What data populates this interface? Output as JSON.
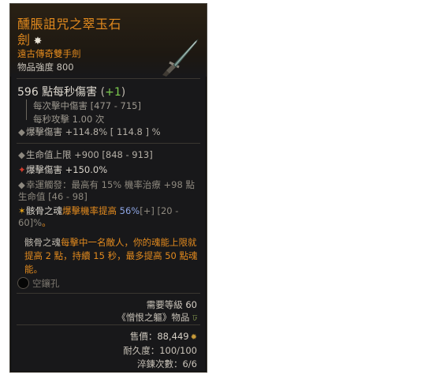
{
  "item": {
    "name_line1": "醺脹詛咒之翠玉石",
    "name_line2": "劍",
    "type": "遠古傳奇雙手劍",
    "power": "物品強度 800"
  },
  "dps": {
    "value": "596 點每秒傷害",
    "open": "(",
    "bonus": "+1",
    "close": ")"
  },
  "damage_details": {
    "hit": "每次擊中傷害 [477 - 715]",
    "speed": "每秒攻擊 1.00 次",
    "crit": "爆擊傷害 +114.8%  [ 114.8 ] %"
  },
  "affixes": {
    "life": "生命值上限 +900 [848 - 913]",
    "crit_dmg": "爆擊傷害 +150.0%",
    "lucky_hit": "幸運觸發：最高有 15% 機率治療 +98 點生命值 [46 - 98]",
    "aspect_name": "骸骨之魂",
    "aspect_orange": "爆擊機率提高",
    "aspect_value": "56%",
    "aspect_rest": "[+] [20 - 60]%",
    "aspect_dot": "。"
  },
  "description": {
    "part1": "骸骨之魂",
    "part2": "每擊中一名敵人，你的魂能上限就提高 2 點，持續 15 秒，最多提高 50 點魂能。"
  },
  "socket": {
    "label": "空鑲孔"
  },
  "footer": {
    "level_label": "需要等級",
    "level_value": "60",
    "source": "《憎恨之軀》物品",
    "price_label": "售價：",
    "price_value": "88,449",
    "durability": "耐久度：100/100",
    "temper": "淬鍊次數：6/6"
  },
  "colors": {
    "legendary": "#e28a1e",
    "bonus_green": "#7ccb4e",
    "highlight_blue": "#8ea6e6",
    "background": "#18181a"
  },
  "icons": [
    "sword-icon",
    "star-icon",
    "socket-icon",
    "gold-coin-icon",
    "expansion-d-icon"
  ]
}
